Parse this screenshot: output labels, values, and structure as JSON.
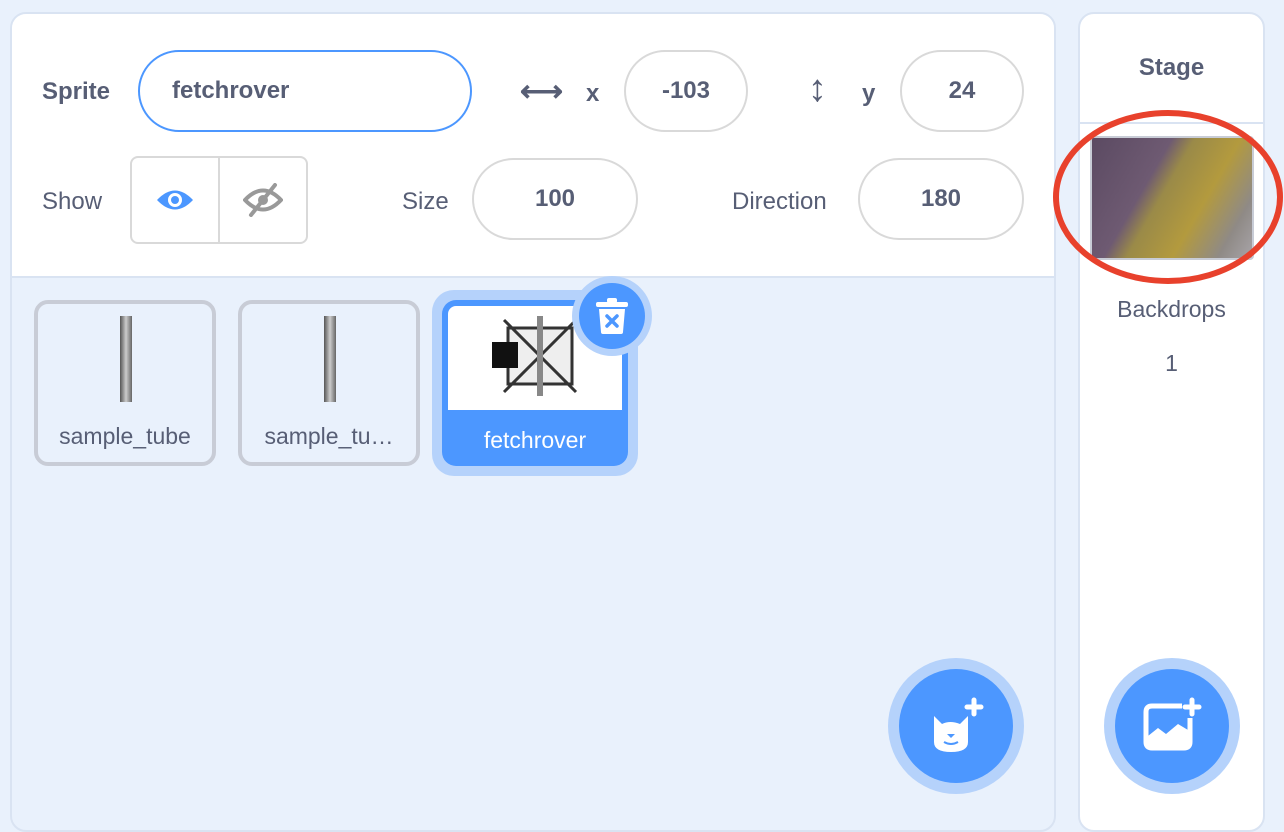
{
  "sprite_info": {
    "sprite_label": "Sprite",
    "sprite_name": "fetchrover",
    "x_label": "x",
    "x_value": "-103",
    "y_label": "y",
    "y_value": "24",
    "show_label": "Show",
    "size_label": "Size",
    "size_value": "100",
    "direction_label": "Direction",
    "direction_value": "180"
  },
  "sprites": [
    {
      "name": "sample_tube"
    },
    {
      "name": "sample_tu…"
    },
    {
      "name": "fetchrover",
      "selected": true
    }
  ],
  "stage": {
    "title": "Stage",
    "backdrops_label": "Backdrops",
    "backdrops_count": "1"
  },
  "colors": {
    "accent": "#4c97ff",
    "annotation": "#e8412c"
  }
}
